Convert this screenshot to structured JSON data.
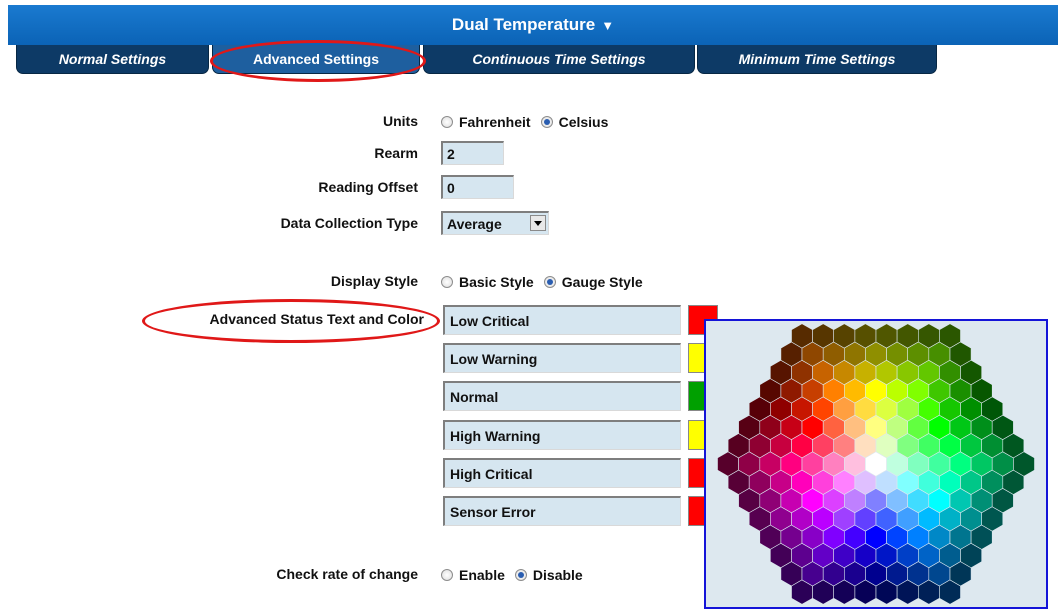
{
  "header": {
    "title": "Dual Temperature",
    "arrow": "▼"
  },
  "tabs": [
    {
      "label": "Normal Settings",
      "active": false
    },
    {
      "label": "Advanced Settings",
      "active": true
    },
    {
      "label": "Continuous Time Settings",
      "active": false
    },
    {
      "label": "Minimum Time Settings",
      "active": false
    }
  ],
  "form": {
    "units": {
      "label": "Units",
      "options": [
        "Fahrenheit",
        "Celsius"
      ],
      "selected": "Celsius"
    },
    "rearm": {
      "label": "Rearm",
      "value": "2"
    },
    "reading_offset": {
      "label": "Reading Offset",
      "value": "0"
    },
    "data_collection_type": {
      "label": "Data Collection Type",
      "value": "Average"
    },
    "display_style": {
      "label": "Display Style",
      "options": [
        "Basic Style",
        "Gauge Style"
      ],
      "selected": "Gauge Style"
    },
    "advanced_status": {
      "label": "Advanced Status Text and Color",
      "rows": [
        {
          "text": "Low Critical",
          "color": "#ff0000"
        },
        {
          "text": "Low Warning",
          "color": "#ffff00"
        },
        {
          "text": "Normal",
          "color": "#00a000"
        },
        {
          "text": "High Warning",
          "color": "#ffff00"
        },
        {
          "text": "High Critical",
          "color": "#ff0000"
        },
        {
          "text": "Sensor Error",
          "color": "#ff0000"
        }
      ]
    },
    "check_rate_of_change": {
      "label": "Check rate of change",
      "options": [
        "Enable",
        "Disable"
      ],
      "selected": "Disable"
    }
  },
  "colors": {
    "title_bar": "#0b63b6",
    "tab_bg": "#0d3a66",
    "tab_active_bg": "#1e5f9f",
    "annotation": "#e01818",
    "field_bg": "#d6e6f0",
    "picker_border": "#1414d8"
  }
}
